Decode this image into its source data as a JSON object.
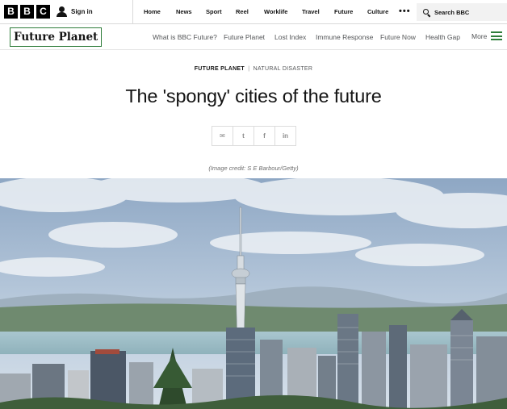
{
  "top_bar": {
    "logo_letters": [
      "B",
      "B",
      "C"
    ],
    "sign_in": "Sign in",
    "nav_items": [
      "Home",
      "News",
      "Sport",
      "Reel",
      "Worklife",
      "Travel",
      "Future",
      "Culture"
    ],
    "more_dots": "•••",
    "search_label": "Search BBC"
  },
  "section_bar": {
    "brand": "Future Planet",
    "nav_items": [
      "What is BBC Future?",
      "Future Planet",
      "Lost Index",
      "Immune Response",
      "Future Now",
      "Health Gap"
    ],
    "more_label": "More",
    "accent_color": "#2e7d3a"
  },
  "article": {
    "kicker_section": "FUTURE PLANET",
    "kicker_separator": "|",
    "kicker_topic": "NATURAL DISASTER",
    "title": "The 'spongy' cities of the future",
    "share_buttons": [
      {
        "icon": "email-icon",
        "glyph": "✉"
      },
      {
        "icon": "twitter-icon",
        "glyph": "t"
      },
      {
        "icon": "facebook-icon",
        "glyph": "f"
      },
      {
        "icon": "linkedin-icon",
        "glyph": "in"
      }
    ],
    "image_credit": "(Image credit: S E Barbour/Getty)"
  }
}
